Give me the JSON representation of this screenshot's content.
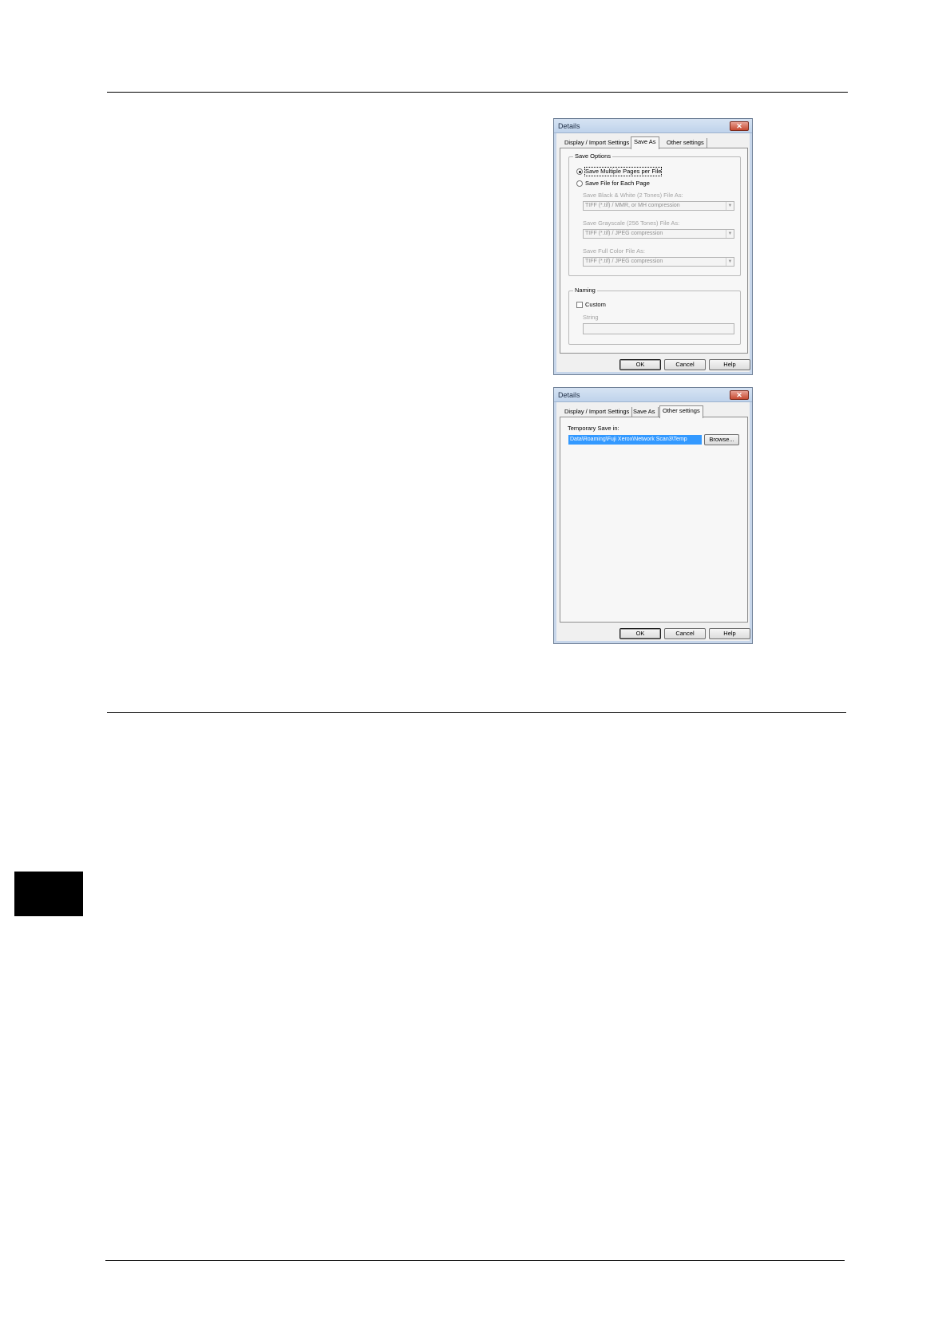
{
  "dialog1": {
    "title": "Details",
    "close_glyph": "✕",
    "tabs": [
      {
        "label": "Display / Import Settings"
      },
      {
        "label": "Save As"
      },
      {
        "label": "Other settings"
      }
    ],
    "active_tab": "Save As",
    "save_options": {
      "legend": "Save Options",
      "option_multiple": "Save Multiple Pages per File",
      "option_each": "Save File for Each Page",
      "selected": "Save Multiple Pages per File",
      "bw_label": "Save Black & White (2 Tones) File As:",
      "bw_value": "TIFF (*.tif) / MMR, or MH compression",
      "gray_label": "Save Grayscale (256 Tones) File As:",
      "gray_value": "TIFF (*.tif) / JPEG compression",
      "color_label": "Save Full Color File As:",
      "color_value": "TIFF (*.tif) / JPEG compression"
    },
    "naming": {
      "legend": "Naming",
      "custom_label": "Custom",
      "custom_checked": false,
      "string_label": "String",
      "string_value": ""
    },
    "buttons": {
      "ok": "OK",
      "cancel": "Cancel",
      "help": "Help"
    }
  },
  "dialog2": {
    "title": "Details",
    "close_glyph": "✕",
    "tabs": [
      {
        "label": "Display / Import Settings"
      },
      {
        "label": "Save As"
      },
      {
        "label": "Other settings"
      }
    ],
    "active_tab": "Other settings",
    "temporary_save_label": "Temporary Save in:",
    "temporary_save_path": "Data\\Roaming\\Fuji Xerox\\Network Scan3\\Temp",
    "browse_label": "Browse...",
    "buttons": {
      "ok": "OK",
      "cancel": "Cancel",
      "help": "Help"
    }
  },
  "icons": {
    "close": "close-icon",
    "dropdown": "chevron-down-icon"
  },
  "colors": {
    "dialog_face": "#f0f0f0",
    "selection": "#3399ff",
    "close_button": "#c74b33",
    "side_tab": "#000000"
  }
}
